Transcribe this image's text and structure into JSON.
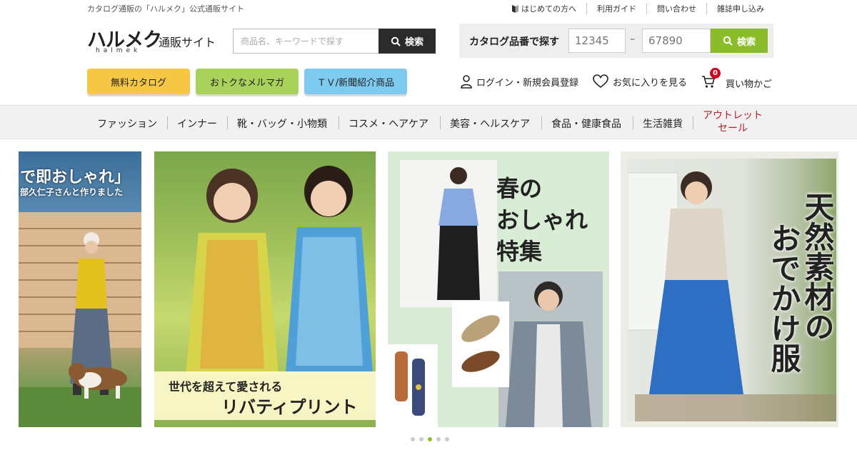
{
  "topbar": {
    "tagline": "カタログ通販の「ハルメク」公式通販サイト",
    "links": [
      "はじめての方へ",
      "利用ガイド",
      "問い合わせ",
      "雑誌申し込み"
    ]
  },
  "logo": {
    "main": "ハルメク",
    "sub": "通販サイト",
    "roman": "halmek"
  },
  "search": {
    "placeholder": "商品名、キーワードで探す",
    "button": "検索"
  },
  "catalog_search": {
    "label": "カタログ品番で探す",
    "field1_placeholder": "12345",
    "dash": "–",
    "field2_placeholder": "67890",
    "button": "検索"
  },
  "pills": [
    "無料カタログ",
    "おトクなメルマガ",
    "ＴＶ/新聞紹介商品"
  ],
  "account": {
    "login": "ログイン・新規会員登録",
    "favorites": "お気に入りを見る",
    "cart": "買い物かご",
    "cart_count": "0"
  },
  "categories": [
    "ファッション",
    "インナー",
    "靴・バッグ・小物類",
    "コスメ・ヘアケア",
    "美容・ヘルスケア",
    "食品・健康食品",
    "生活雑貨"
  ],
  "outlet": {
    "line1": "アウトレット",
    "line2": "セール"
  },
  "banners": {
    "b1_line1": "で即おしゃれ」",
    "b1_line2": "部久仁子さんと作りました",
    "b2_caption1": "世代を超えて愛される",
    "b2_caption2": "リバティプリント",
    "b3_title": [
      "春の",
      "おしゃれ",
      "特集"
    ],
    "b4_title1": "天然素材の",
    "b4_title2": "おでかけ服"
  },
  "carousel": {
    "count": 5,
    "active_index": 2
  },
  "colors": {
    "search_button": "#2b2b2b",
    "catalog_button": "#8bbd2a",
    "outlet": "#b3202a",
    "badge": "#d0021b"
  }
}
